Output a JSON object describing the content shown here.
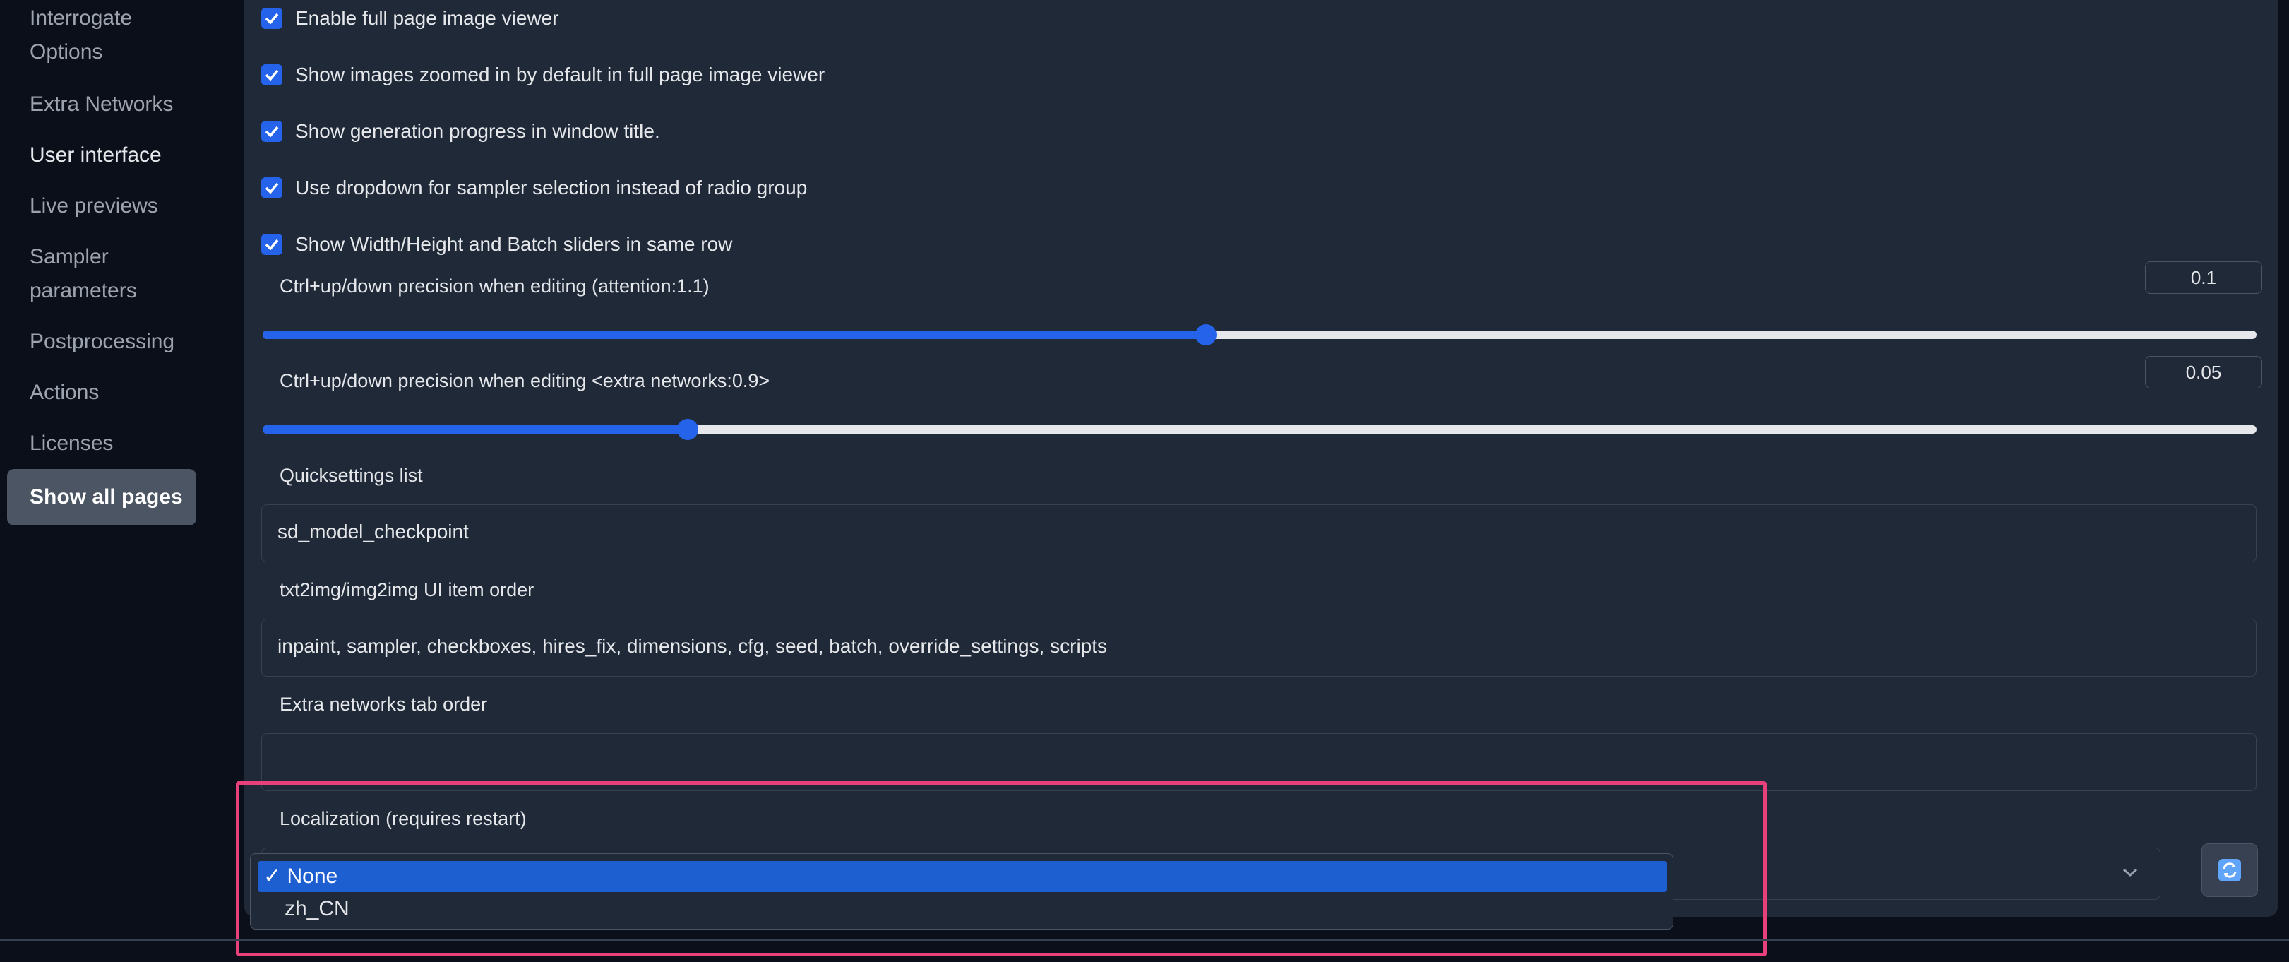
{
  "sidebar": {
    "items": [
      {
        "label": "Interrogate"
      },
      {
        "label": "Options"
      },
      {
        "label": "Extra Networks"
      },
      {
        "label": "User interface"
      },
      {
        "label": "Live previews"
      },
      {
        "label": "Sampler"
      },
      {
        "label": "parameters"
      },
      {
        "label": "Postprocessing"
      },
      {
        "label": "Actions"
      },
      {
        "label": "Licenses"
      },
      {
        "label": "Show all pages"
      }
    ]
  },
  "settings": {
    "checkboxes": [
      {
        "label": "Enable full page image viewer",
        "checked": true
      },
      {
        "label": "Show images zoomed in by default in full page image viewer",
        "checked": true
      },
      {
        "label": "Show generation progress in window title.",
        "checked": true
      },
      {
        "label": "Use dropdown for sampler selection instead of radio group",
        "checked": true
      },
      {
        "label": "Show Width/Height and Batch sliders in same row",
        "checked": true
      }
    ],
    "attention_precision": {
      "label": "Ctrl+up/down precision when editing (attention:1.1)",
      "value": "0.1",
      "fraction": 0.473
    },
    "extra_precision": {
      "label": "Ctrl+up/down precision when editing <extra networks:0.9>",
      "value": "0.05",
      "fraction": 0.213
    },
    "quicksettings": {
      "label": "Quicksettings list",
      "value": "sd_model_checkpoint"
    },
    "ui_order": {
      "label": "txt2img/img2img UI item order",
      "value": "inpaint, sampler, checkboxes, hires_fix, dimensions, cfg, seed, batch, override_settings, scripts"
    },
    "extra_tab_order": {
      "label": "Extra networks tab order",
      "value": ""
    },
    "localization": {
      "label": "Localization (requires restart)",
      "options": [
        {
          "label": "✓ None",
          "selected": true
        },
        {
          "label": "zh_CN",
          "selected": false
        }
      ]
    }
  },
  "colors": {
    "accent": "#2563eb",
    "highlight": "#e8407a",
    "selected_option": "#1d5fd1"
  }
}
